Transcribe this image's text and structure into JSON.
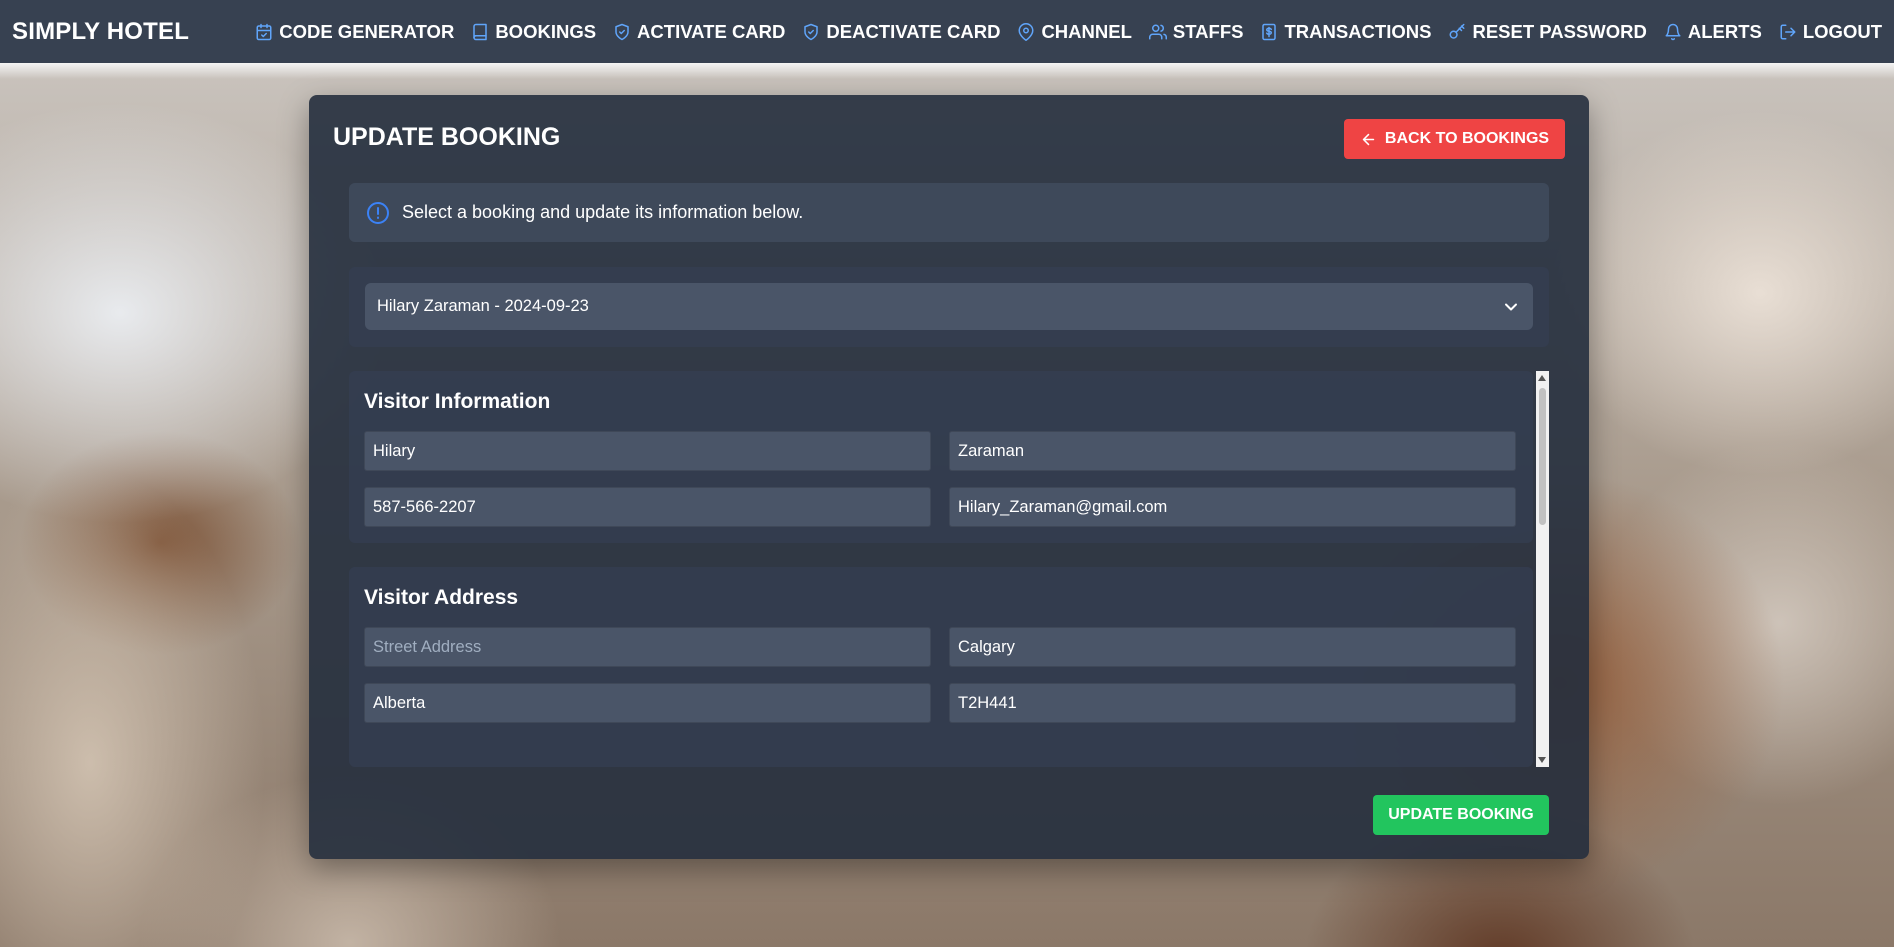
{
  "app": {
    "brand": "SIMPLY HOTEL"
  },
  "nav": {
    "items": [
      {
        "label": "CODE GENERATOR",
        "icon": "calendar-check-icon"
      },
      {
        "label": "BOOKINGS",
        "icon": "book-icon"
      },
      {
        "label": "ACTIVATE CARD",
        "icon": "shield-check-icon"
      },
      {
        "label": "DEACTIVATE CARD",
        "icon": "shield-check-icon"
      },
      {
        "label": "CHANNEL",
        "icon": "map-pin-icon"
      },
      {
        "label": "STAFFS",
        "icon": "users-icon"
      },
      {
        "label": "TRANSACTIONS",
        "icon": "receipt-dollar-icon"
      },
      {
        "label": "RESET PASSWORD",
        "icon": "key-icon"
      },
      {
        "label": "ALERTS",
        "icon": "bell-icon"
      },
      {
        "label": "LOGOUT",
        "icon": "logout-icon"
      }
    ],
    "accent_color": "#60a5fa"
  },
  "page": {
    "title": "UPDATE BOOKING",
    "back_button": "BACK TO BOOKINGS",
    "info_text": "Select a booking and update its information below.",
    "booking_select": {
      "selected": "Hilary Zaraman - 2024-09-23"
    },
    "visitor_info": {
      "heading": "Visitor Information",
      "first_name": "Hilary",
      "last_name": "Zaraman",
      "phone": "587-566-2207",
      "email": "Hilary_Zaraman@gmail.com"
    },
    "visitor_address": {
      "heading": "Visitor Address",
      "street_placeholder": "Street Address",
      "city": "Calgary",
      "province": "Alberta",
      "postal_code": "T2H441"
    },
    "update_button": "UPDATE BOOKING"
  },
  "colors": {
    "nav_bg": "#374151",
    "back_button": "#ef4444",
    "update_button": "#22c55e",
    "info_icon": "#3b82f6"
  }
}
